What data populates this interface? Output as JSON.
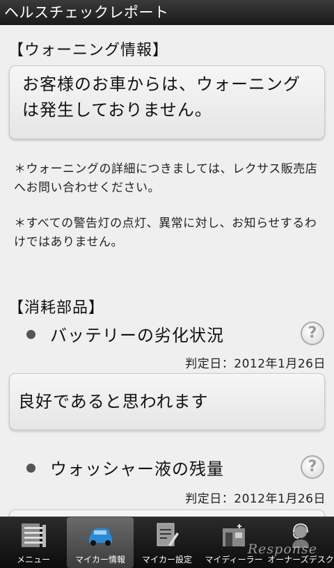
{
  "header": {
    "title": "ヘルスチェックレポート"
  },
  "warning": {
    "section_title": "【ウォーニング情報】",
    "message": "お客様のお車からは、ウォーニングは発生しておりません。",
    "note1": "＊ウォーニングの詳細につきましては、レクサス販売店へお問い合わせください。",
    "note2": "＊すべての警告灯の点灯、異常に対し、お知らせするわけではありません。"
  },
  "consumables": {
    "section_title": "【消耗部品】",
    "items": [
      {
        "label": "バッテリーの劣化状況",
        "help": "?",
        "date": "判定日：2012年1月26日",
        "result": "良好であると思われます"
      },
      {
        "label": "ウォッシャー液の残量",
        "help": "?",
        "date": "判定日：2012年1月26日"
      }
    ]
  },
  "tabs": [
    {
      "label": "メニュー",
      "icon": "menu-icon"
    },
    {
      "label": "マイカー情報",
      "icon": "car-icon",
      "active": true
    },
    {
      "label": "マイカー設定",
      "icon": "settings-document-icon"
    },
    {
      "label": "マイディーラー",
      "icon": "dealer-icon"
    },
    {
      "label": "オーナーズデスク",
      "icon": "headset-operator-icon"
    }
  ],
  "watermark": "Response",
  "colors": {
    "tab_bar": "#1a1a1a",
    "active_tab": "#5a5a5a",
    "car_blue": "#2a8ad6",
    "background": "#efefef"
  }
}
